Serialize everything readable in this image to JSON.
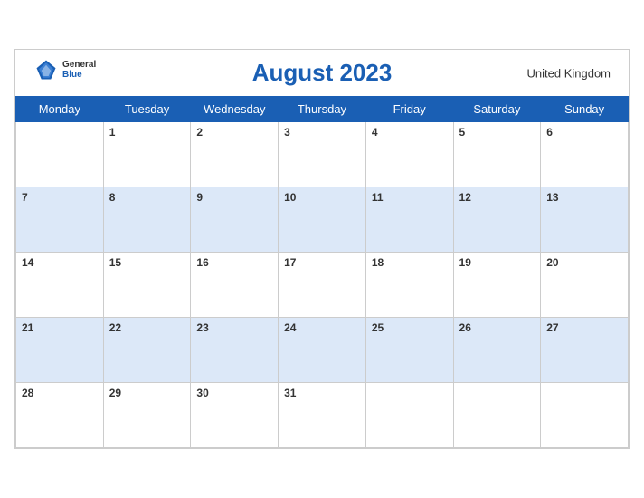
{
  "header": {
    "title": "August 2023",
    "region": "United Kingdom",
    "logo_general": "General",
    "logo_blue": "Blue"
  },
  "weekdays": [
    "Monday",
    "Tuesday",
    "Wednesday",
    "Thursday",
    "Friday",
    "Saturday",
    "Sunday"
  ],
  "weeks": [
    [
      "",
      "1",
      "2",
      "3",
      "4",
      "5",
      "6"
    ],
    [
      "7",
      "8",
      "9",
      "10",
      "11",
      "12",
      "13"
    ],
    [
      "14",
      "15",
      "16",
      "17",
      "18",
      "19",
      "20"
    ],
    [
      "21",
      "22",
      "23",
      "24",
      "25",
      "26",
      "27"
    ],
    [
      "28",
      "29",
      "30",
      "31",
      "",
      "",
      ""
    ]
  ],
  "colors": {
    "header_bg": "#1a5fb4",
    "row_even_bg": "#dce8f8",
    "row_odd_bg": "#ffffff"
  }
}
